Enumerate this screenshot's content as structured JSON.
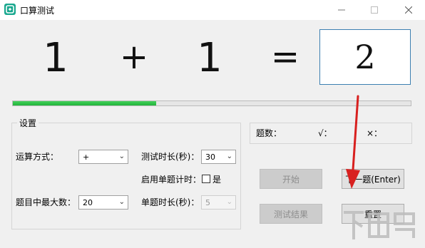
{
  "window": {
    "title": "口算测试",
    "controls": [
      "minimize-icon",
      "maximize-icon",
      "close-icon"
    ]
  },
  "equation": {
    "operand1": "1",
    "operator": "+",
    "operand2": "1",
    "equals": "=",
    "answer": "2"
  },
  "progress": {
    "fraction": 0.36,
    "color": "#2fbf47"
  },
  "settings": {
    "legend": "设置",
    "operation_label": "运算方式：",
    "operation_value": "+",
    "max_number_label": "题目中最大数：",
    "max_number_value": "20",
    "test_duration_label": "测试时长(秒)：",
    "test_duration_value": "30",
    "per_question_timer_label": "启用单题计时：",
    "per_question_timer_checkbox_label": "是",
    "per_question_timer_checked": false,
    "per_question_duration_label": "单题时长(秒)：",
    "per_question_duration_value": "5"
  },
  "stats": {
    "count_label": "题数：",
    "correct_label": "√：",
    "wrong_label": "×："
  },
  "buttons": {
    "start": "开始",
    "next": "下一题(Enter)",
    "results": "测试结果",
    "reset": "重置"
  },
  "annotation": {
    "arrow_color": "#d8201f"
  },
  "watermark": {
    "text": "下载吧"
  }
}
